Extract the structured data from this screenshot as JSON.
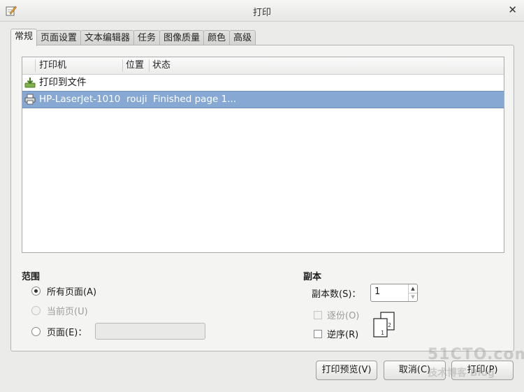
{
  "window": {
    "title": "打印"
  },
  "tabs": [
    "常规",
    "页面设置",
    "文本编辑器",
    "任务",
    "图像质量",
    "颜色",
    "高级"
  ],
  "printer_list": {
    "columns": [
      "打印机",
      "位置",
      "状态"
    ],
    "rows": [
      {
        "name": "打印到文件",
        "location": "",
        "status": "",
        "icon": "print-to-file-icon"
      },
      {
        "name": "HP-LaserJet-1010",
        "location": "rouji",
        "status": "Finished page 1...",
        "icon": "printer-icon"
      }
    ]
  },
  "range": {
    "title": "范围",
    "all_pages": "所有页面(A)",
    "current_page": "当前页(U)",
    "pages": "页面(E)："
  },
  "copies": {
    "title": "副本",
    "count_label": "副本数(S)：",
    "count_value": "1",
    "collate": "逐份(O)",
    "reverse": "逆序(R)",
    "collate_page_labels": [
      "1",
      "2"
    ]
  },
  "buttons": {
    "preview": "打印预览(V)",
    "cancel": "取消(C)",
    "print": "打印(P)"
  },
  "watermark": {
    "line1": "51CTO.com",
    "line2": "技术博客 Blog"
  }
}
